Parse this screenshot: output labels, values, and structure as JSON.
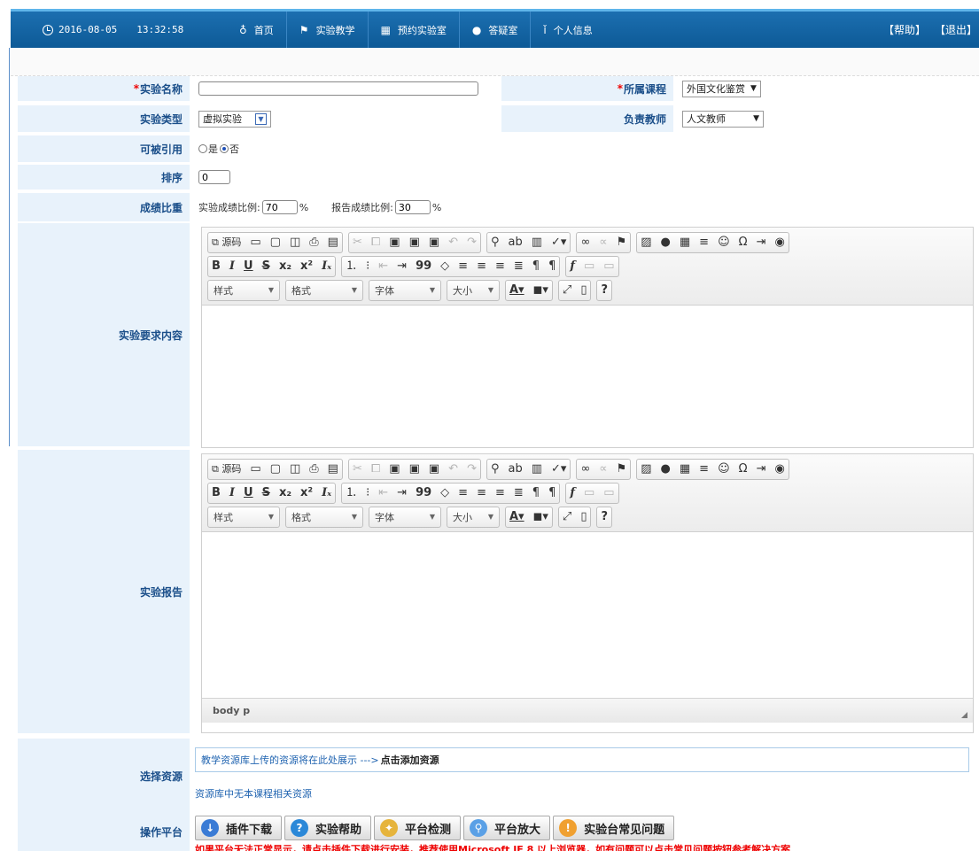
{
  "topbar": {
    "date": "2016-08-05",
    "time": "13:32:58",
    "nav": [
      {
        "label": "首页",
        "icon": "bulb-icon",
        "glyph": "♁"
      },
      {
        "label": "实验教学",
        "icon": "teaching-icon",
        "glyph": "⚑"
      },
      {
        "label": "预约实验室",
        "icon": "calendar-icon",
        "glyph": "▦"
      },
      {
        "label": "答疑室",
        "icon": "chat-icon",
        "glyph": "●"
      },
      {
        "label": "个人信息",
        "icon": "user-icon",
        "glyph": "ǐ"
      }
    ],
    "help": "【帮助】",
    "logout": "【退出】"
  },
  "form": {
    "name_label": "实验名称",
    "course_label": "所属课程",
    "course_value": "外国文化鉴赏",
    "type_label": "实验类型",
    "type_value": "虚拟实验",
    "teacher_label": "负责教师",
    "teacher_value": "人文教师",
    "cite_label": "可被引用",
    "cite_yes": "是",
    "cite_no": "否",
    "order_label": "排序",
    "order_value": "0",
    "score_label": "成绩比重",
    "exp_score_label": "实验成绩比例:",
    "exp_score_value": "70",
    "report_score_label": "报告成绩比例:",
    "report_score_value": "30",
    "percent": "%",
    "req_label": "实验要求内容",
    "report_label": "实验报告",
    "res_label": "选择资源",
    "res_text": "教学资源库上传的资源将在此处展示 --->",
    "res_link": "点击添加资源",
    "res_empty": "资源库中无本课程相关资源",
    "op_label": "操作平台"
  },
  "editor": {
    "source": "源码",
    "style": "样式",
    "format": "格式",
    "font": "字体",
    "size": "大小",
    "status_path": "body  p"
  },
  "ops": [
    {
      "label": "插件下载",
      "icon": "plugin-download-icon",
      "color": "#3a7bd5",
      "glyph": "↓"
    },
    {
      "label": "实验帮助",
      "icon": "help-icon",
      "color": "#2b88d8",
      "glyph": "?"
    },
    {
      "label": "平台检测",
      "icon": "magic-wand-icon",
      "color": "#e6b43c",
      "glyph": "✦"
    },
    {
      "label": "平台放大",
      "icon": "magnifier-icon",
      "color": "#5aa0e6",
      "glyph": "⚲"
    },
    {
      "label": "实验台常见问题",
      "icon": "faq-icon",
      "color": "#f0a030",
      "glyph": "!"
    }
  ],
  "warning": "如果平台无法正常显示，请点击插件下载进行安装，推荐使用Microsoft IE 8 以上浏览器，如有问题可以点击常见问题按钮参考解决方案"
}
